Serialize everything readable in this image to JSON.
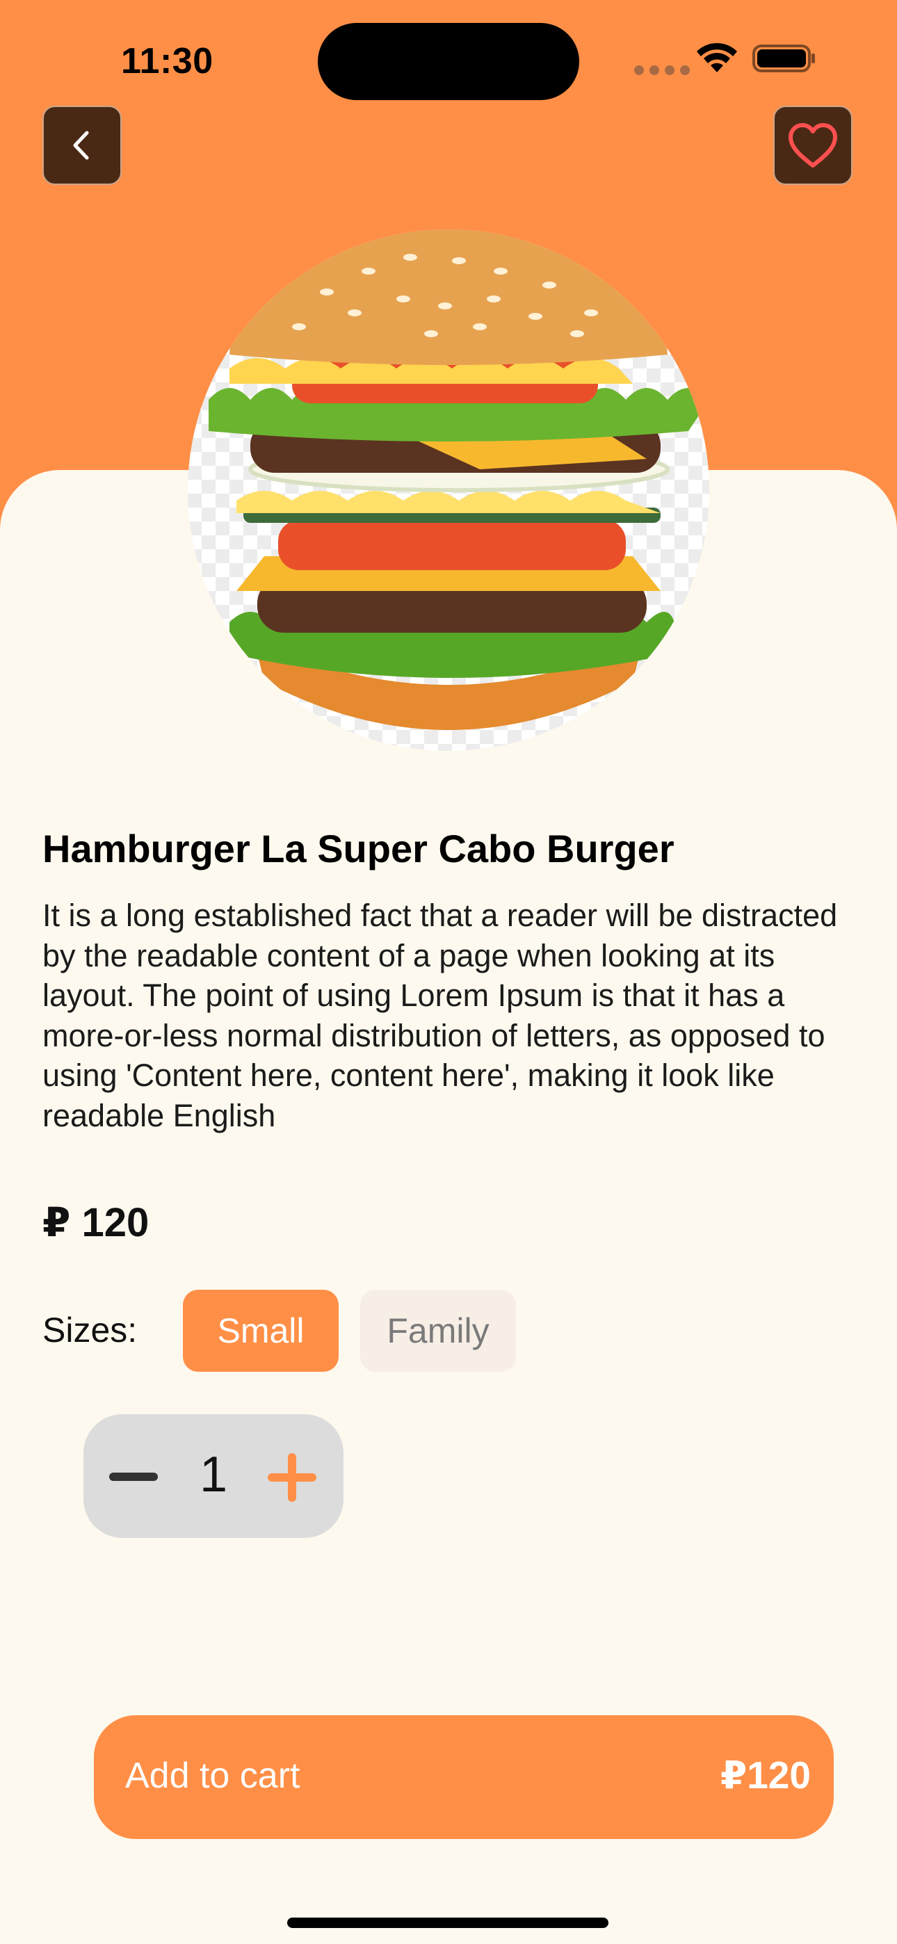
{
  "status_bar": {
    "time": "11:30"
  },
  "colors": {
    "accent": "#FF8F47",
    "dark_button": "#4A2914",
    "sheet": "#FEF9EE"
  },
  "product": {
    "name": "Hamburger La Super Cabo Burger",
    "description": "It is a long established fact that a reader will be distracted by the readable content of a page when looking at its layout. The point of using Lorem Ipsum is that it has a more-or-less normal distribution of letters, as opposed to using 'Content here, content here', making it look like readable English",
    "price": "₽ 120"
  },
  "sizes": {
    "label": "Sizes:",
    "options": [
      "Small",
      "Family"
    ],
    "selected": "Small"
  },
  "quantity": {
    "value": "1"
  },
  "cart": {
    "label": "Add to cart",
    "price": "₽120"
  },
  "icons": {
    "back": "chevron-left-icon",
    "favorite": "heart-icon",
    "minus": "minus-icon",
    "plus": "plus-icon"
  }
}
